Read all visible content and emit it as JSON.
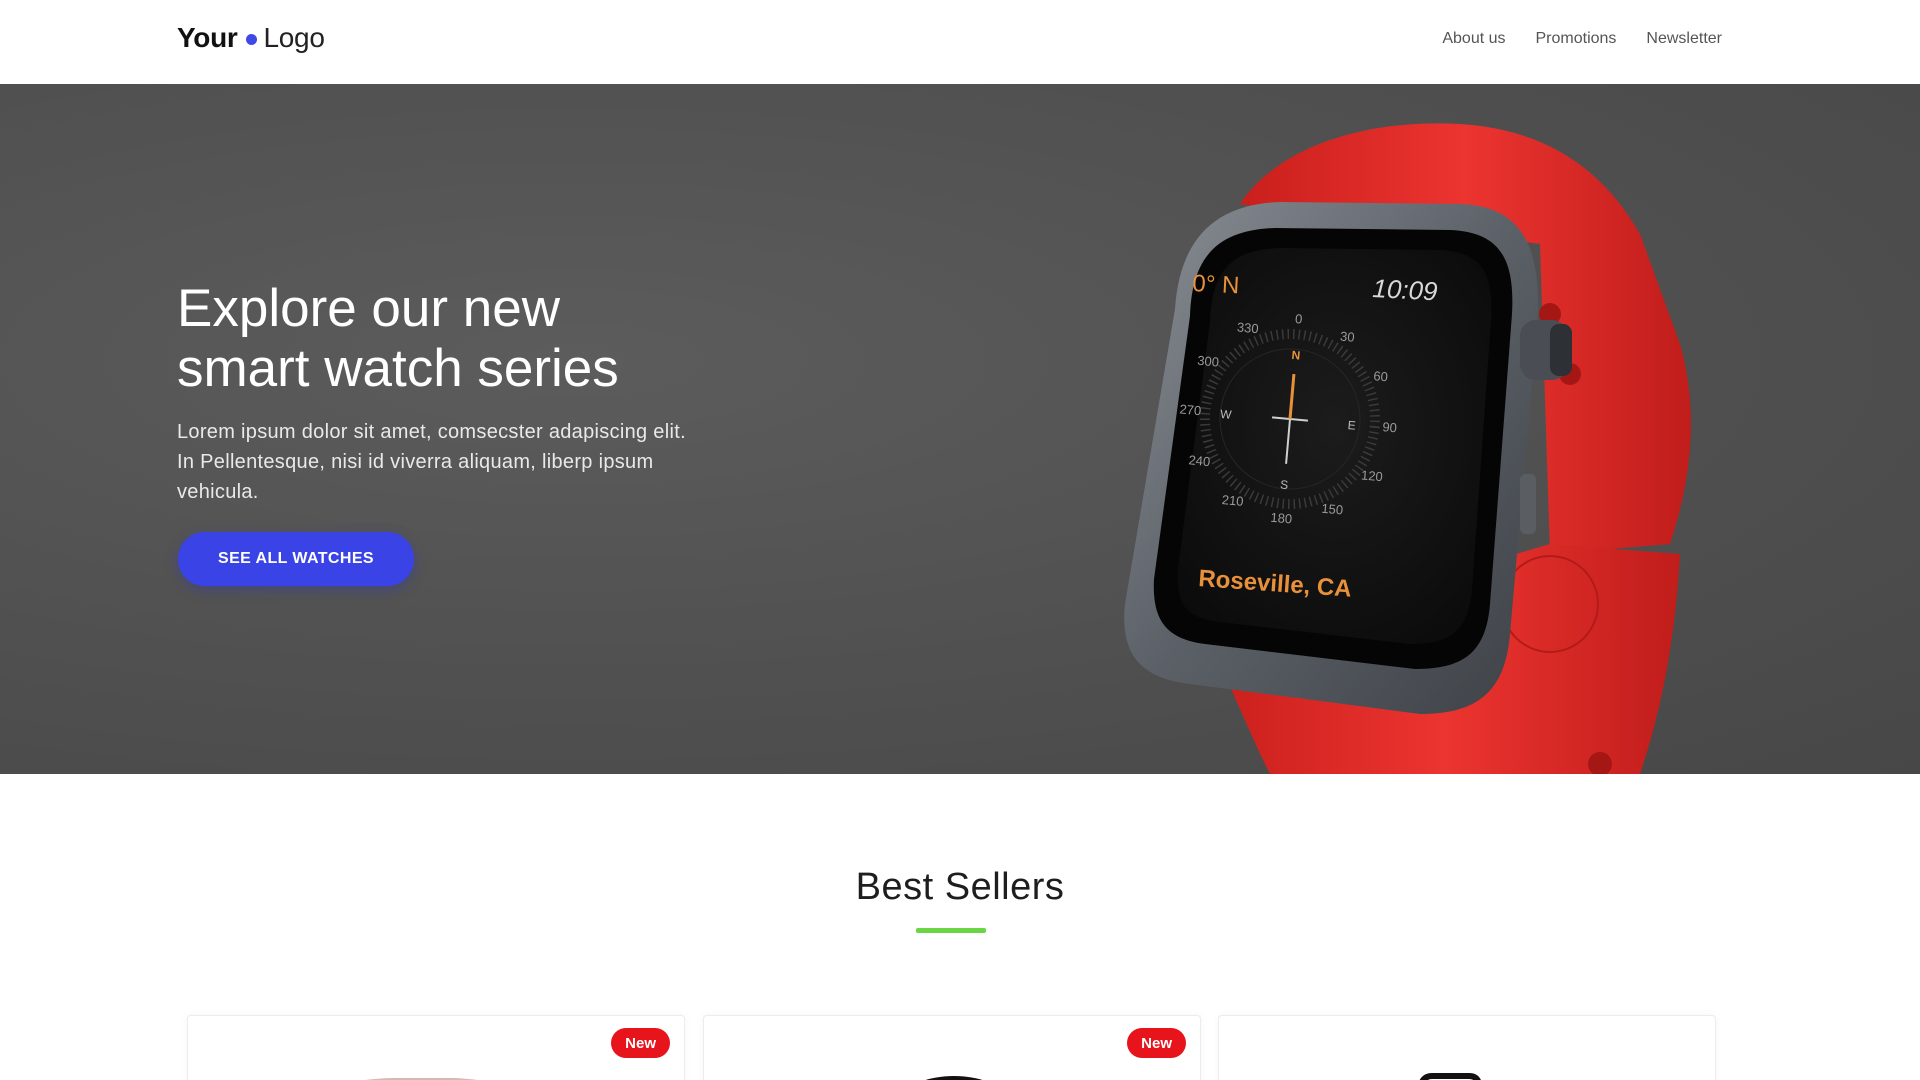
{
  "header": {
    "logo_bold": "Your",
    "logo_light": "Logo",
    "nav": [
      "About us",
      "Promotions",
      "Newsletter"
    ]
  },
  "hero": {
    "title_line1": "Explore our new",
    "title_line2": "smart watch series",
    "text": "Lorem ipsum dolor sit amet, comsecster adapiscing elit. In Pellentesque, nisi id viverra aliquam, liberp ipsum vehicula.",
    "button": "SEE ALL WATCHES",
    "watch_face": {
      "heading": "0° N",
      "time": "10:09",
      "location": "Roseville, CA",
      "north": "N",
      "east": "E",
      "south": "S",
      "west": "W",
      "degrees": [
        "0",
        "30",
        "60",
        "90",
        "120",
        "150",
        "180",
        "210",
        "240",
        "270",
        "300",
        "330"
      ]
    }
  },
  "best_sellers": {
    "title": "Best Sellers",
    "cards": [
      {
        "badge": "New",
        "image": "rose-gold-watch"
      },
      {
        "badge": "New",
        "image": "black-round-watch"
      },
      {
        "badge": "",
        "image": "black-square-watch"
      }
    ]
  },
  "colors": {
    "accent": "#3a44e6",
    "badge": "#e8141b",
    "underline": "#6ad645",
    "band": "#e8302c"
  }
}
